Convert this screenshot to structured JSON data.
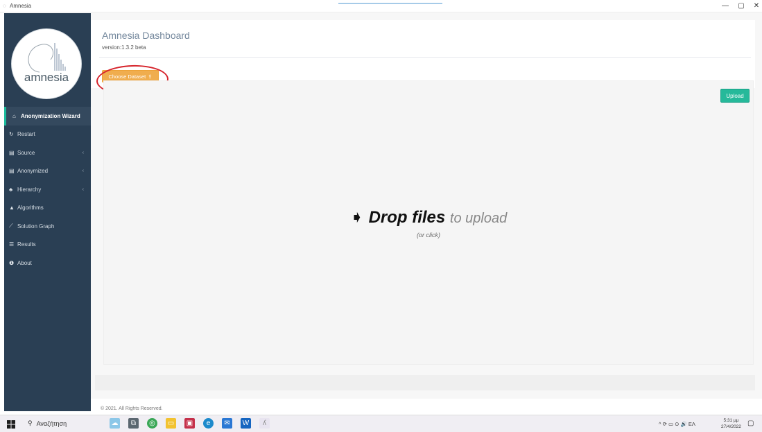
{
  "window": {
    "title": "Amnesia",
    "minimize": "—",
    "maximize": "▢",
    "close": "✕"
  },
  "logo": {
    "text": "amnesia"
  },
  "sidebar": {
    "items": [
      {
        "label": "Anonymization Wizard",
        "icon": "home-icon",
        "glyph": "⌂",
        "active": true,
        "has_arrow": false
      },
      {
        "label": "Restart",
        "icon": "refresh-icon",
        "glyph": "↻",
        "active": false,
        "has_arrow": false
      },
      {
        "label": "Source",
        "icon": "table-icon",
        "glyph": "▤",
        "active": false,
        "has_arrow": true
      },
      {
        "label": "Anonymized",
        "icon": "table-icon",
        "glyph": "▤",
        "active": false,
        "has_arrow": true
      },
      {
        "label": "Hierarchy",
        "icon": "sitemap-icon",
        "glyph": "♣",
        "active": false,
        "has_arrow": true
      },
      {
        "label": "Algorithms",
        "icon": "flask-icon",
        "glyph": "▲",
        "active": false,
        "has_arrow": false
      },
      {
        "label": "Solution Graph",
        "icon": "line-chart-icon",
        "glyph": "⟋",
        "active": false,
        "has_arrow": false
      },
      {
        "label": "Results",
        "icon": "list-icon",
        "glyph": "☰",
        "active": false,
        "has_arrow": false
      },
      {
        "label": "About",
        "icon": "info-icon",
        "glyph": "❶",
        "active": false,
        "has_arrow": false
      }
    ],
    "arrow_glyph": "‹"
  },
  "header": {
    "title": "Amnesia Dashboard",
    "version": "version:1.3.2 beta"
  },
  "actions": {
    "choose_dataset": "Choose Dataset",
    "upload": "Upload"
  },
  "dropzone": {
    "bold": "Drop files",
    "light": "to upload",
    "sub": "(or click)"
  },
  "footer": {
    "text": "© 2021. All Rights Reserved."
  },
  "taskbar": {
    "search": "Αναζήτηση",
    "tray": "^  ⟳  ▭  ⊙  🔊  ΕΛ",
    "time": "5:31 μμ",
    "date": "27/4/2022"
  },
  "colors": {
    "sidebar_bg": "#2a3f54",
    "accent_green": "#26b99a",
    "button_orange": "#f0ad4e",
    "annotation_red": "#d6232b"
  }
}
